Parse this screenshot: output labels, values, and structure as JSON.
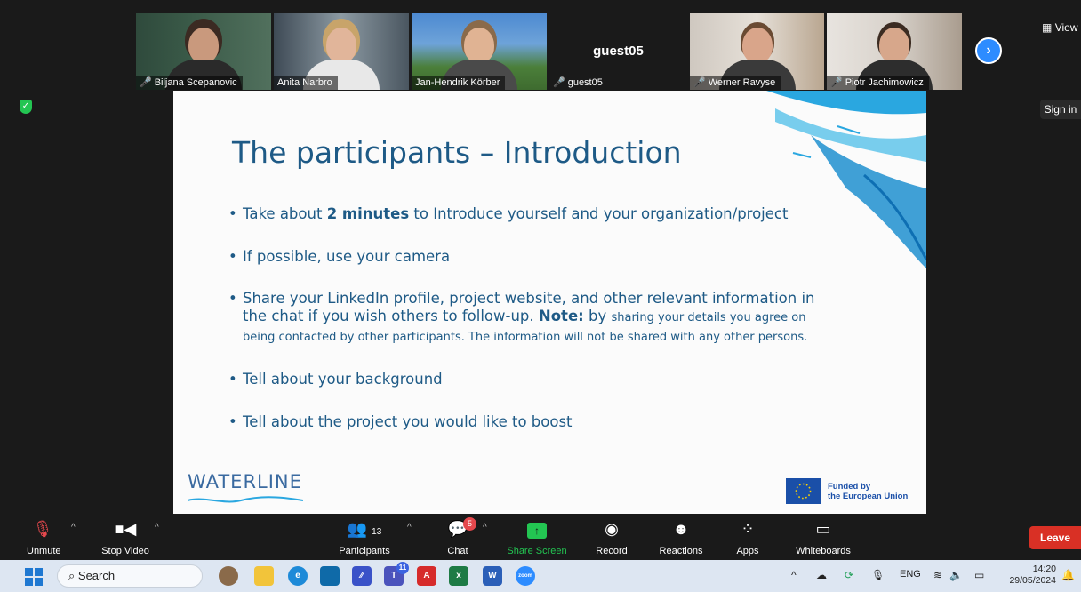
{
  "participants": [
    {
      "name": "Biljana Scepanovic",
      "muted": true
    },
    {
      "name": "Anita Narbro",
      "muted": false
    },
    {
      "name": "Jan-Hendrik Körber",
      "muted": false
    },
    {
      "name": "guest05",
      "muted": true
    },
    {
      "name": "Werner Ravyse",
      "muted": true
    },
    {
      "name": "Piotr Jachimowicz",
      "muted": true
    }
  ],
  "guest_display": "guest05",
  "top_right": {
    "view": "View",
    "sign_in": "Sign in"
  },
  "slide": {
    "title": "The participants – Introduction",
    "bullet1_pre": "Take about ",
    "bullet1_bold": "2 minutes",
    "bullet1_post": " to Introduce yourself and your organization/project",
    "bullet2": "If possible, use your camera",
    "bullet3_line1": "Share your LinkedIn profile,  project website, and other relevant information in",
    "bullet3_line2_pre": "the chat if you wish others to follow-up. ",
    "bullet3_note": "Note:",
    "bullet3_line2_post": " by ",
    "bullet3_small1": "sharing your details you agree on",
    "bullet3_small2": "being contacted by other participants. The information will not be shared with any other persons.",
    "bullet4": "Tell about your background",
    "bullet5": "Tell about the project you would like to boost",
    "logo": "WATERLINE",
    "eu_line1": "Funded by",
    "eu_line2": "the European Union"
  },
  "controls": {
    "unmute": "Unmute",
    "stop_video": "Stop Video",
    "participants": "Participants",
    "participants_count": "13",
    "chat": "Chat",
    "chat_badge": "5",
    "share_screen": "Share Screen",
    "record": "Record",
    "reactions": "Reactions",
    "apps": "Apps",
    "whiteboards": "Whiteboards",
    "leave": "Leave"
  },
  "taskbar": {
    "search": "Search",
    "teams_badge": "11",
    "lang": "ENG",
    "time": "14:20",
    "date": "29/05/2024"
  },
  "colors": {
    "accent_blue": "#2d8cff",
    "share_green": "#23c552",
    "leave_red": "#d93025",
    "slide_text": "#1e5a86"
  }
}
